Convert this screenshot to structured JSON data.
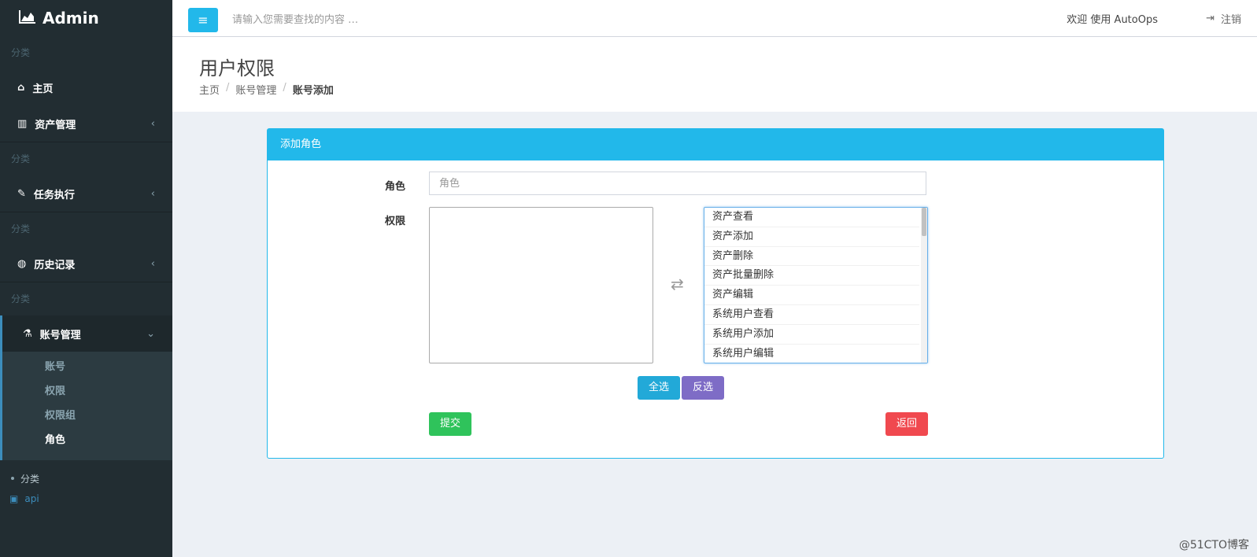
{
  "brand": {
    "title": "Admin"
  },
  "sidebar": {
    "sections": [
      {
        "category": "分类",
        "items": [
          {
            "label": "主页",
            "icon": "home-icon"
          },
          {
            "label": "资产管理",
            "icon": "bar-chart-icon"
          }
        ]
      },
      {
        "category": "分类",
        "items": [
          {
            "label": "任务执行",
            "icon": "edit-icon"
          }
        ]
      },
      {
        "category": "分类",
        "items": [
          {
            "label": "历史记录",
            "icon": "compass-icon"
          }
        ]
      },
      {
        "category": "分类",
        "items": [
          {
            "label": "账号管理",
            "icon": "flask-icon"
          }
        ]
      }
    ],
    "sub_items": [
      "账号",
      "权限",
      "权限组",
      "角色"
    ],
    "bottom": {
      "category": "分类",
      "api": "api"
    }
  },
  "topbar": {
    "search_hint": "请输入您需要查找的内容 …",
    "welcome": "欢迎 使用 AutoOps",
    "logout": "注销"
  },
  "header": {
    "title": "用户权限",
    "breadcrumb": [
      "主页",
      "账号管理",
      "账号添加"
    ]
  },
  "panel": {
    "title": "添加角色",
    "role_label": "角色",
    "role_placeholder": "角色",
    "perm_label": "权限",
    "options": [
      "资产查看",
      "资产添加",
      "资产删除",
      "资产批量删除",
      "资产编辑",
      "系统用户查看",
      "系统用户添加",
      "系统用户编辑"
    ],
    "select_all": "全选",
    "invert": "反选",
    "submit": "提交",
    "back": "返回"
  },
  "watermark": "@51CTO博客",
  "colors": {
    "accent": "#22b8ea",
    "success": "#2fc35b",
    "danger": "#f0494f",
    "purple": "#7e6cc6",
    "sidebar_bg": "#222d32"
  }
}
